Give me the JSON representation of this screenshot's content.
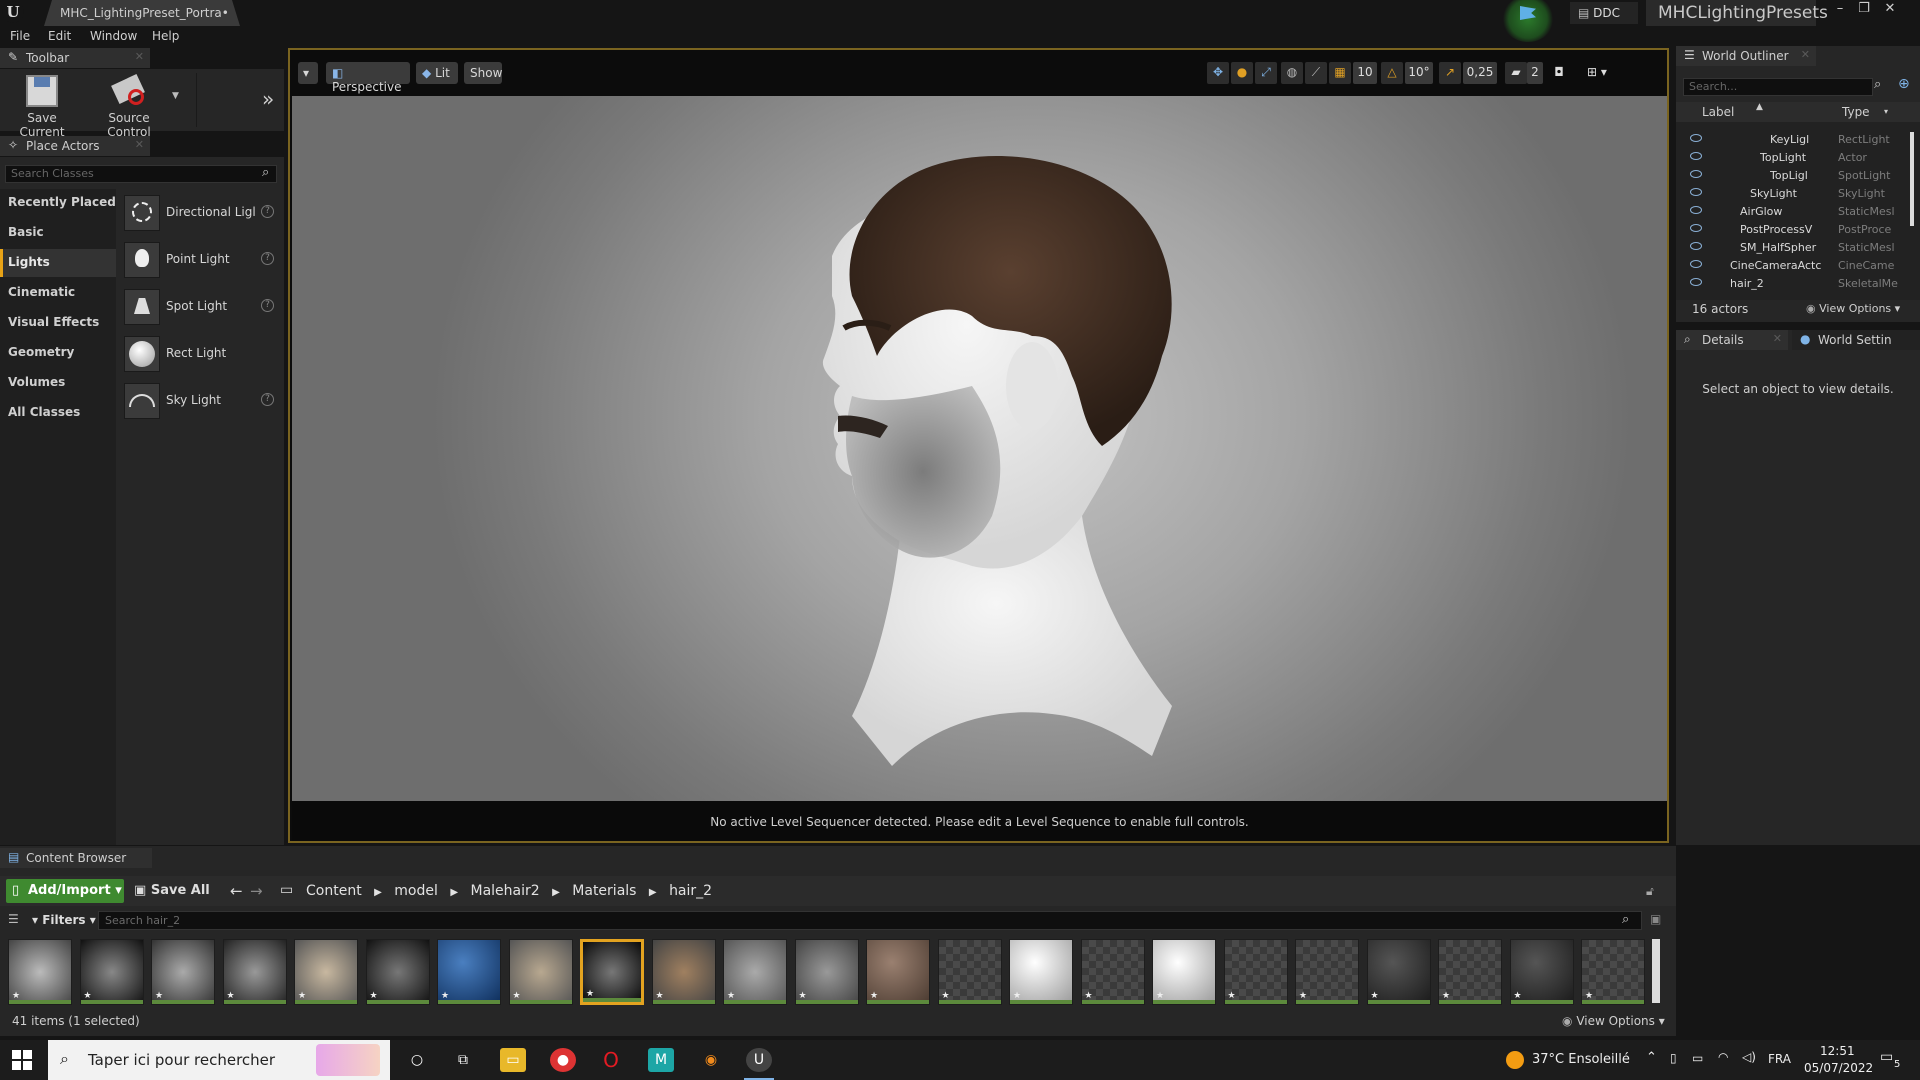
{
  "window": {
    "document_tab": "MHC_LightingPreset_Portra•",
    "ddc_label": "DDC",
    "project_name": "MHCLightingPresets",
    "controls": [
      "–",
      "❐",
      "✕"
    ]
  },
  "menu": [
    "File",
    "Edit",
    "Window",
    "Help"
  ],
  "toolbar_panel": {
    "title": "Toolbar",
    "save_label": "Save Current",
    "source_label": "Source Control",
    "more": "»"
  },
  "place_actors": {
    "title": "Place Actors",
    "search_placeholder": "Search Classes",
    "categories": [
      "Recently Placed",
      "Basic",
      "Lights",
      "Cinematic",
      "Visual Effects",
      "Geometry",
      "Volumes",
      "All Classes"
    ],
    "active_category": "Lights",
    "actors": [
      {
        "name": "Directional Ligl",
        "help": true
      },
      {
        "name": "Point Light",
        "help": true
      },
      {
        "name": "Spot Light",
        "help": true
      },
      {
        "name": "Rect Light",
        "help": false
      },
      {
        "name": "Sky Light",
        "help": true
      }
    ]
  },
  "viewport": {
    "menu_arrow": "▾",
    "perspective": "Perspective",
    "lit": "Lit",
    "show": "Show",
    "grid_snap": "10",
    "rotation_snap": "10°",
    "scale_snap": "0,25",
    "camera_speed": "2",
    "sequencer_message": "No active Level Sequencer detected. Please edit a Level Sequence to enable full controls."
  },
  "outliner": {
    "title": "World Outliner",
    "search_placeholder": "Search...",
    "col_label": "Label",
    "col_type": "Type",
    "rows": [
      {
        "label": "KeyLigl",
        "type": "RectLight",
        "indent": 94
      },
      {
        "label": "TopLight",
        "type": "Actor",
        "indent": 84
      },
      {
        "label": "TopLigl",
        "type": "SpotLight",
        "indent": 94
      },
      {
        "label": "SkyLight",
        "type": "SkyLight",
        "indent": 74
      },
      {
        "label": "AirGlow",
        "type": "StaticMesl",
        "indent": 64
      },
      {
        "label": "PostProcessV",
        "type": "PostProce",
        "indent": 64
      },
      {
        "label": "SM_HalfSpher",
        "type": "StaticMesl",
        "indent": 64
      },
      {
        "label": "CineCameraActc",
        "type": "CineCame",
        "indent": 54
      },
      {
        "label": "hair_2",
        "type": "SkeletalMe",
        "indent": 54
      }
    ],
    "count": "16 actors",
    "view_options": "View Options"
  },
  "details": {
    "tab": "Details",
    "world_tab": "World Settin",
    "empty_message": "Select an object to view details."
  },
  "content_browser": {
    "title": "Content Browser",
    "add_import": "Add/Import",
    "save_all": "Save All",
    "path": [
      "Content",
      "model",
      "Malehair2",
      "Materials",
      "hair_2"
    ],
    "filters": "Filters",
    "search_placeholder": "Search hair_2",
    "status": "41 items (1 selected)",
    "view_options": "View Options",
    "selected_index": 8
  },
  "taskbar": {
    "search_placeholder": "Taper ici pour rechercher",
    "weather": "37°C  Ensoleillé",
    "lang": "FRA",
    "time": "12:51",
    "date": "05/07/2022",
    "notif_count": "5"
  }
}
